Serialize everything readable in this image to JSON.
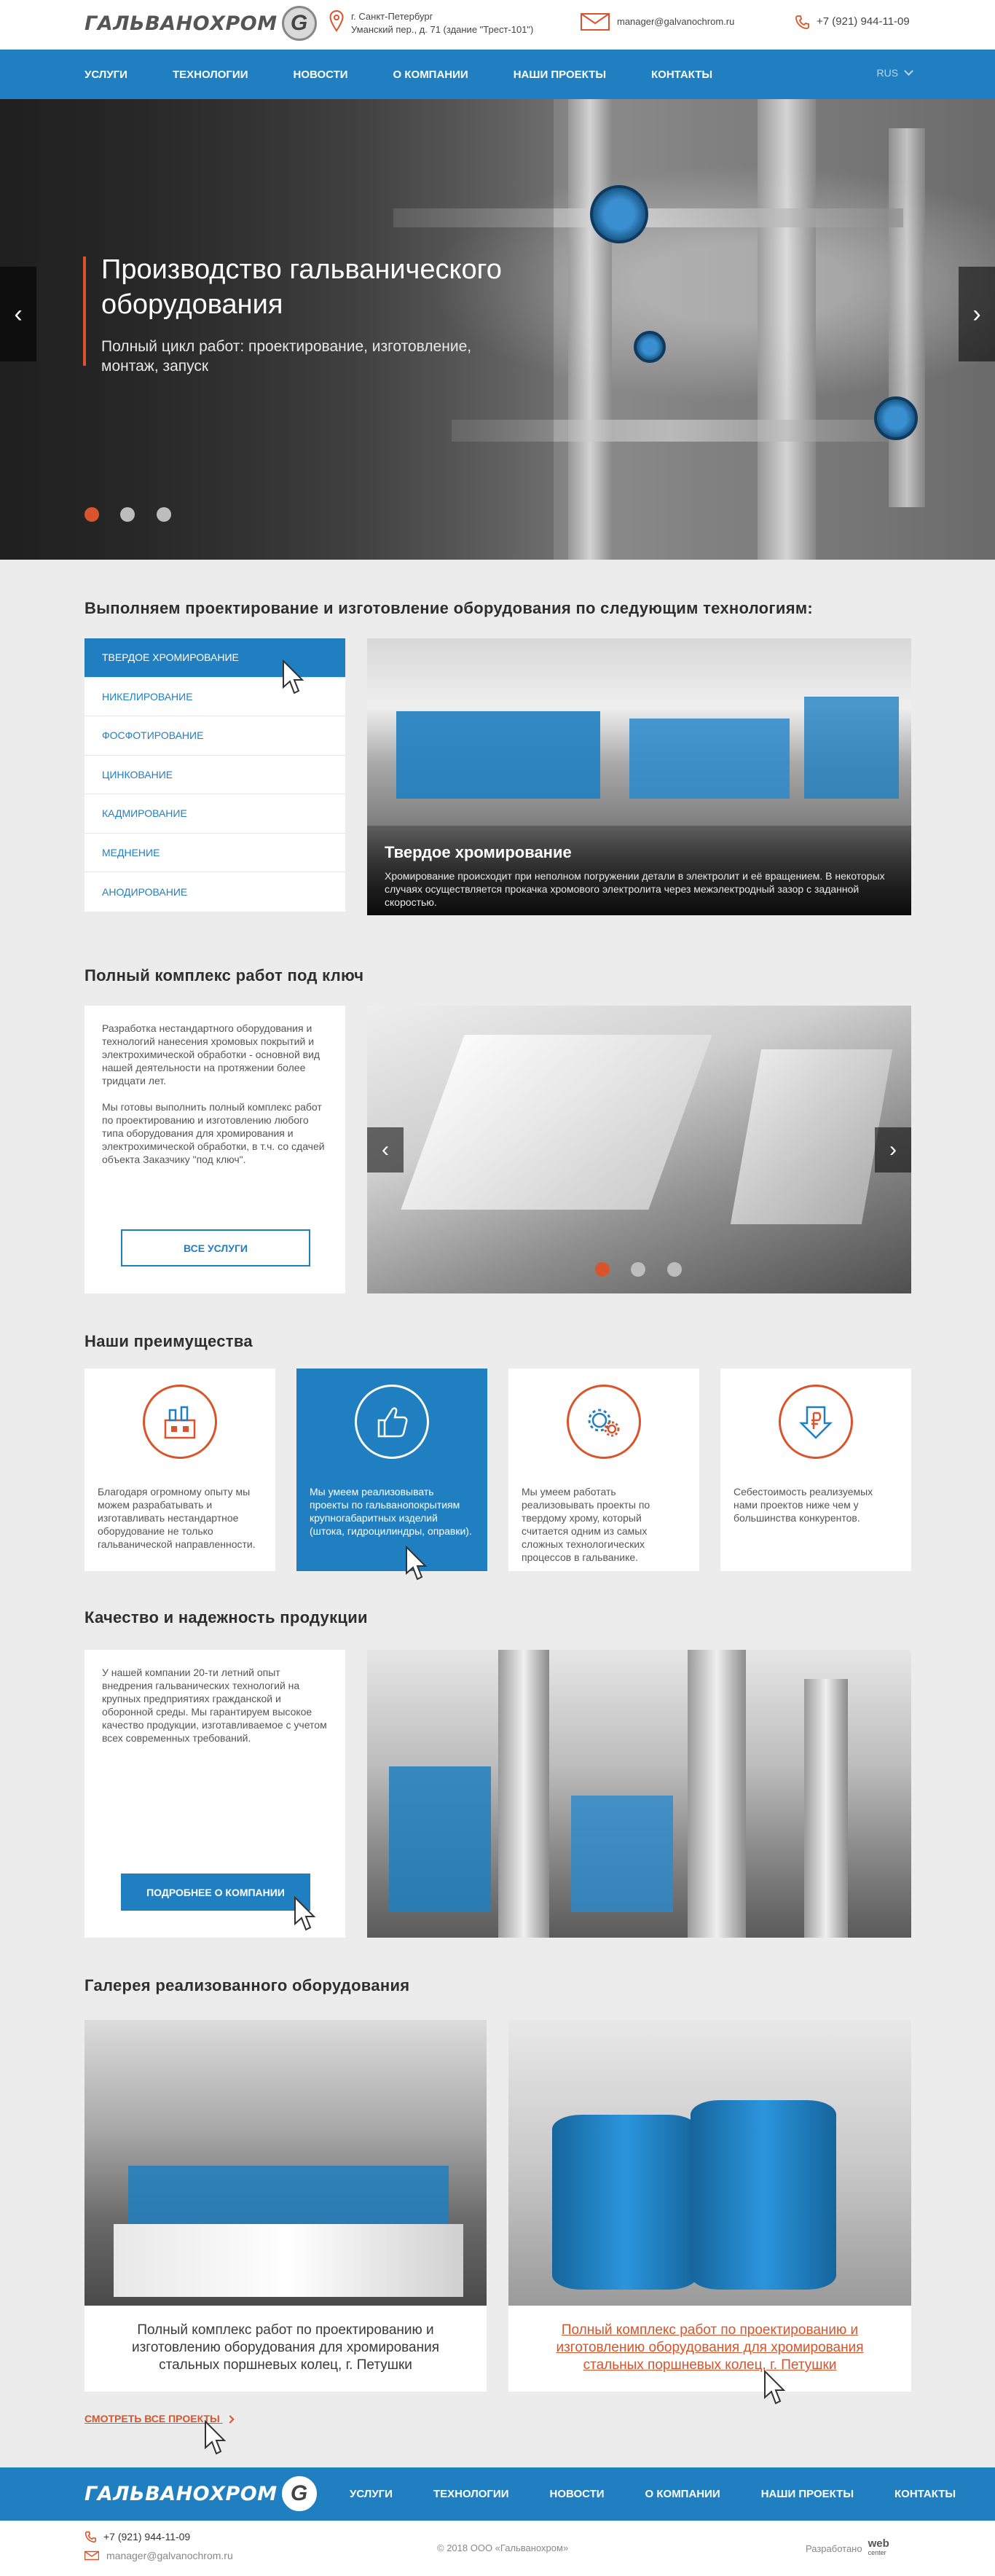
{
  "header": {
    "logo_text": "ГАЛЬВАНОХРОМ",
    "logo_letter": "G",
    "city": "г. Санкт-Петербург",
    "address": "Уманский пер., д. 71 (здание \"Трест-101\")",
    "email": "manager@galvanochrom.ru",
    "phone": "+7 (921) 944-11-09"
  },
  "nav": {
    "items": [
      "Услуги",
      "Технологии",
      "Новости",
      "О компании",
      "Наши проекты",
      "Контакты"
    ],
    "lang": "RUS"
  },
  "hero": {
    "title": "Производство гальванического оборудования",
    "subtitle": "Полный цикл работ: проектирование, изготовление, монтаж, запуск",
    "prev": "‹",
    "next": "›"
  },
  "technologies": {
    "title": "Выполняем проектирование и изготовление оборудования по следующим технологиям:",
    "items": [
      "Твердое хромирование",
      "Никелирование",
      "Фосфотирование",
      "Цинкование",
      "Кадмирование",
      "Меднение",
      "Анодирование"
    ],
    "caption_title": "Твердое хромирование",
    "caption_text": "Хромирование происходит при неполном погружении детали в электролит и её вращением. В некоторых случаях осуществляется прокачка хромового электролита через межэлектродный зазор с заданной скоростью."
  },
  "turnkey": {
    "title": "Полный комплекс работ под ключ",
    "para1": "Разработка нестандартного оборудования и технологий нанесения хромовых покрытий и электрохимической обработки - основной вид нашей деятельности на протяжении более тридцати лет.",
    "para2": "Мы готовы выполнить полный комплекс работ по проектированию и изготовлению любого типа оборудования для хромирования и электрохимической обработки, в т.ч. со сдачей объекта Заказчику \"под ключ\".",
    "button": "Все услуги",
    "prev": "‹",
    "next": "›"
  },
  "advantages": {
    "title": "Наши преимущества",
    "items": [
      "Благодаря огромному опыту мы можем разрабатывать и изготавливать нестандартное оборудование не только гальванической направленности.",
      "Мы умеем реализовывать проекты по гальванопокрытиям крупногабаритных изделий (штока, гидроцилиндры, оправки).",
      "Мы умеем работать реализовывать проекты по твердому хрому, который считается одним из самых сложных технологических процессов в гальванике.",
      "Себестоимость реализуемых нами проектов ниже чем у большинства конкурентов."
    ]
  },
  "quality": {
    "title": "Качество и надежность продукции",
    "text": "У нашей компании 20-ти летний опыт внедрения гальванических технологий на крупных предприятиях гражданской и оборонной среды. Мы гарантируем высокое качество продукции, изготавливаемое с учетом всех современных требований.",
    "button": "Подробнее о компании"
  },
  "gallery": {
    "title": "Галерея реализованного оборудования",
    "items": [
      "Полный комплекс работ по проектированию и изготовлению оборудования для хромирования стальных поршневых колец, г. Петушки",
      "Полный комплекс работ по проектированию и изготовлению оборудования для хромирования стальных поршневых колец, г. Петушки"
    ],
    "all_link": "Смотреть все проекты"
  },
  "footer": {
    "logo_text": "ГАЛЬВАНОХРОМ",
    "logo_letter": "G",
    "nav": [
      "Услуги",
      "Технологии",
      "Новости",
      "О компании",
      "Наши проекты",
      "Контакты"
    ],
    "phone": "+7 (921) 944-11-09",
    "email": "manager@galvanochrom.ru",
    "copyright": "© 2018 ООО «Гальванохром»",
    "dev_label": "Разработано",
    "dev_brand": "web",
    "dev_sub": "center"
  },
  "colors": {
    "accent": "#1f7fc0",
    "orange": "#d9542a"
  }
}
